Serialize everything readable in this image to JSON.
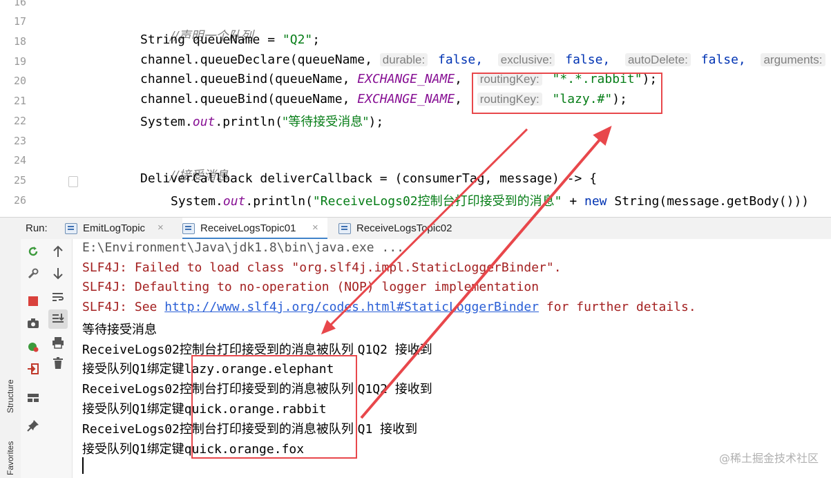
{
  "editor": {
    "line_numbers": [
      "16",
      "17",
      "18",
      "19",
      "20",
      "21",
      "22",
      "23",
      "24",
      "25",
      "26"
    ],
    "lines": {
      "l17_comment": "//声明一个队列",
      "l18_a": "String queueName = ",
      "l18_str": "\"Q2\"",
      "l18_b": ";",
      "l19_a": "channel.queueDeclare(queueName, ",
      "l19_h1": "durable:",
      "l19_v1": " false,  ",
      "l19_h2": "exclusive:",
      "l19_v2": " false,  ",
      "l19_h3": "autoDelete:",
      "l19_v3": " false,  ",
      "l19_h4": "arguments:",
      "l20_a": "channel.queueBind(queueName, ",
      "l20_field": "EXCHANGE_NAME",
      "l20_b": ",  ",
      "l20_hint": "routingKey:",
      "l20_str": " \"*.*.rabbit\"",
      "l20_c": ");",
      "l21_a": "channel.queueBind(queueName, ",
      "l21_field": "EXCHANGE_NAME",
      "l21_b": ",  ",
      "l21_hint": "routingKey:",
      "l21_str": " \"lazy.#\"",
      "l21_c": ");",
      "l22_a": "System.",
      "l22_out": "out",
      "l22_b": ".println(",
      "l22_str": "\"等待接受消息\"",
      "l22_c": ");",
      "l24_comment": "//接受消息",
      "l25": "DeliverCallback deliverCallback = (consumerTag, message) -> {",
      "l26_a": "System.",
      "l26_out": "out",
      "l26_b": ".println(",
      "l26_str": "\"ReceiveLogs02控制台打印接受到的消息\"",
      "l26_c": " + ",
      "l26_kw": "new",
      "l26_d": " String(message.getBody()))"
    }
  },
  "run_window": {
    "title": "Run:",
    "tabs": [
      {
        "label": "EmitLogTopic",
        "close": "×"
      },
      {
        "label": "ReceiveLogsTopic01",
        "close": "×"
      },
      {
        "label": "ReceiveLogsTopic02",
        "close": ""
      }
    ],
    "side_labels": {
      "structure": "Structure",
      "favorites": "Favorites"
    }
  },
  "console": {
    "path": "E:\\Environment\\Java\\jdk1.8\\bin\\java.exe ...",
    "slf4j_1": "SLF4J: Failed to load class \"org.slf4j.impl.StaticLoggerBinder\".",
    "slf4j_2": "SLF4J: Defaulting to no-operation (NOP) logger implementation",
    "slf4j_3_a": "SLF4J: See ",
    "slf4j_3_link": "http://www.slf4j.org/codes.html#StaticLoggerBinder",
    "slf4j_3_b": " for further details.",
    "waiting": "等待接受消息",
    "msg1_a": "ReceiveLogs02",
    "msg1_b": "控制台打印接受到的消息被队列 ",
    "msg1_c": "Q1Q2 ",
    "msg1_d": "接收到",
    "bind1_a": "接受队列",
    "bind1_b": "Q1",
    "bind1_c": "绑定键",
    "bind1_key": "lazy.orange.elephant",
    "msg2_a": "ReceiveLogs02",
    "msg2_b": "控制台打印接受到的消息被队列 ",
    "msg2_c": "Q1Q2 ",
    "msg2_d": "接收到",
    "bind2_a": "接受队列",
    "bind2_b": "Q1",
    "bind2_c": "绑定键",
    "bind2_key": "quick.orange.rabbit",
    "msg3_a": "ReceiveLogs02",
    "msg3_b": "控制台打印接受到的消息被队列 ",
    "msg3_c": "Q1 ",
    "msg3_d": "接收到",
    "bind3_a": "接受队列",
    "bind3_b": "Q1",
    "bind3_c": "绑定键",
    "bind3_key": "quick.orange.fox"
  },
  "watermark": "@稀土掘金技术社区",
  "colors": {
    "annotation_red": "#e8474b",
    "string_green": "#067d17",
    "keyword_blue": "#0033b3",
    "field_purple": "#871094",
    "error_red": "#a32020",
    "link_blue": "#2a5fd6"
  }
}
